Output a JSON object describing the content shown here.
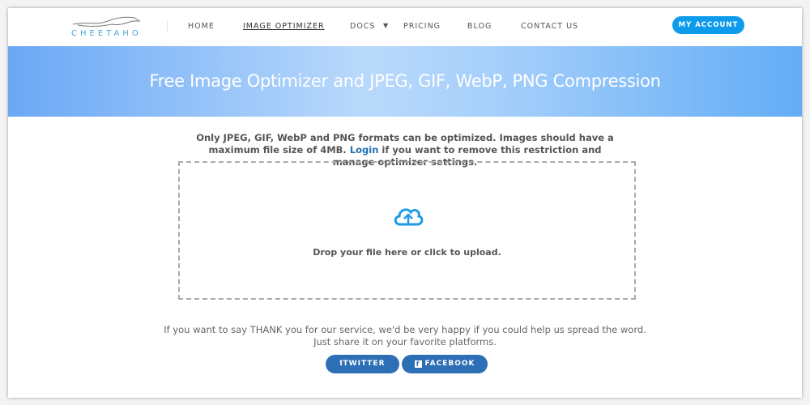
{
  "nav": {
    "logo": "CHEETAHO",
    "items": [
      {
        "label": "HOME"
      },
      {
        "label": "IMAGE OPTIMIZER"
      },
      {
        "label": "DOCS"
      },
      {
        "label": "PRICING"
      },
      {
        "label": "BLOG"
      },
      {
        "label": "CONTACT US"
      }
    ],
    "account": "MY ACCOUNT"
  },
  "hero": {
    "title": "Free Image Optimizer and JPEG, GIF, WebP, PNG Compression"
  },
  "info": {
    "line1": "Only JPEG, GIF, WebP and PNG formats can be optimized. Images should have a maximum file size of 4MB.",
    "login": "Login",
    "line2": "if you want to remove this restriction and manage optimizer settings."
  },
  "upload": {
    "icon": "cloud-upload-icon",
    "text": "Drop your file here or click to upload."
  },
  "share": {
    "line1": "If you want to say THANK you for our service, we'd be very happy if you could help us spread the word.",
    "line2": "Just share it on your favorite platforms.",
    "twitter": "TWITTER",
    "facebook": "FACEBOOK"
  },
  "colors": {
    "accent": "#0f9bec",
    "share_button": "#2c6fb5",
    "link": "#1e6fb3"
  }
}
